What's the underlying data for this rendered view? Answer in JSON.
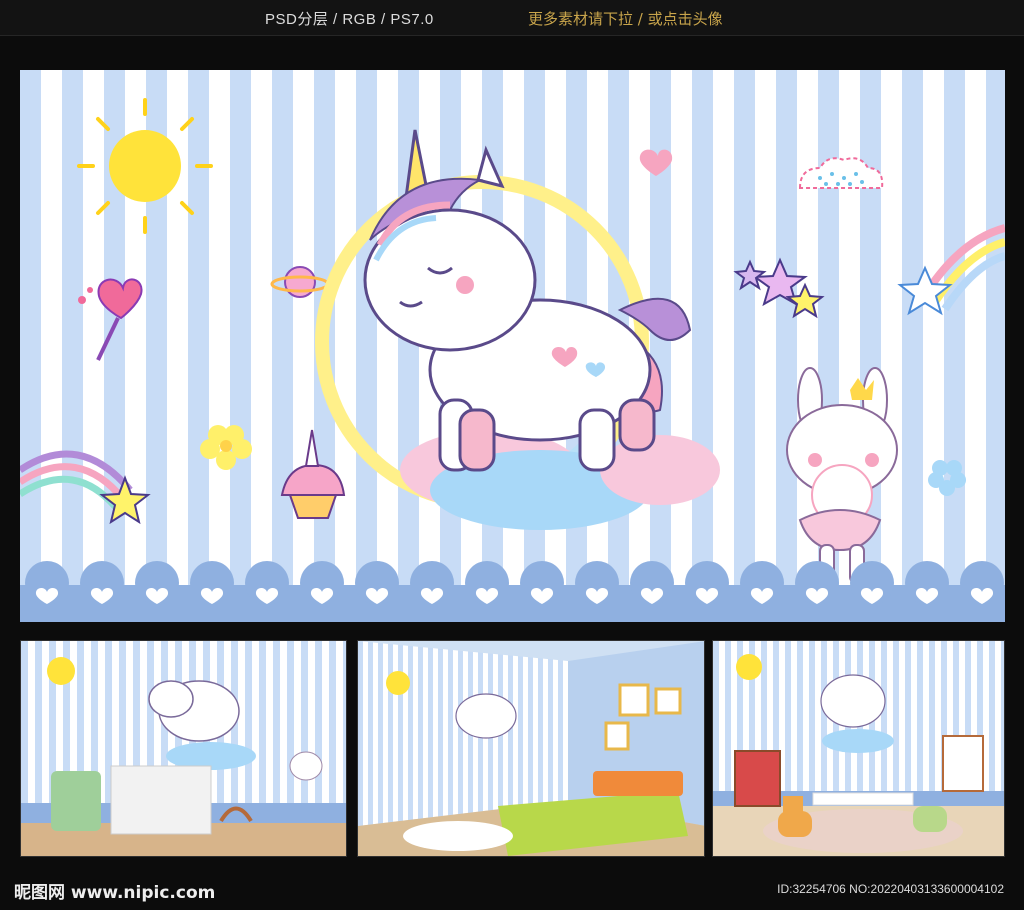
{
  "header": {
    "format_text": "PSD分层 /  RGB / PS7.0",
    "hint_text": "更多素材请下拉 / 或点击头像"
  },
  "footer": {
    "logo_text": "昵图网 www.nipic.com",
    "id_text": "ID:32254706 NO:20220403133600004102"
  },
  "colors": {
    "stripe_blue": "#c8dcf6",
    "border_blue": "#8fb0e0",
    "sun_yellow": "#ffe33a",
    "pink": "#f6a5c0",
    "unicorn_white": "#ffffff"
  },
  "thumbnails": {
    "count": 3
  }
}
